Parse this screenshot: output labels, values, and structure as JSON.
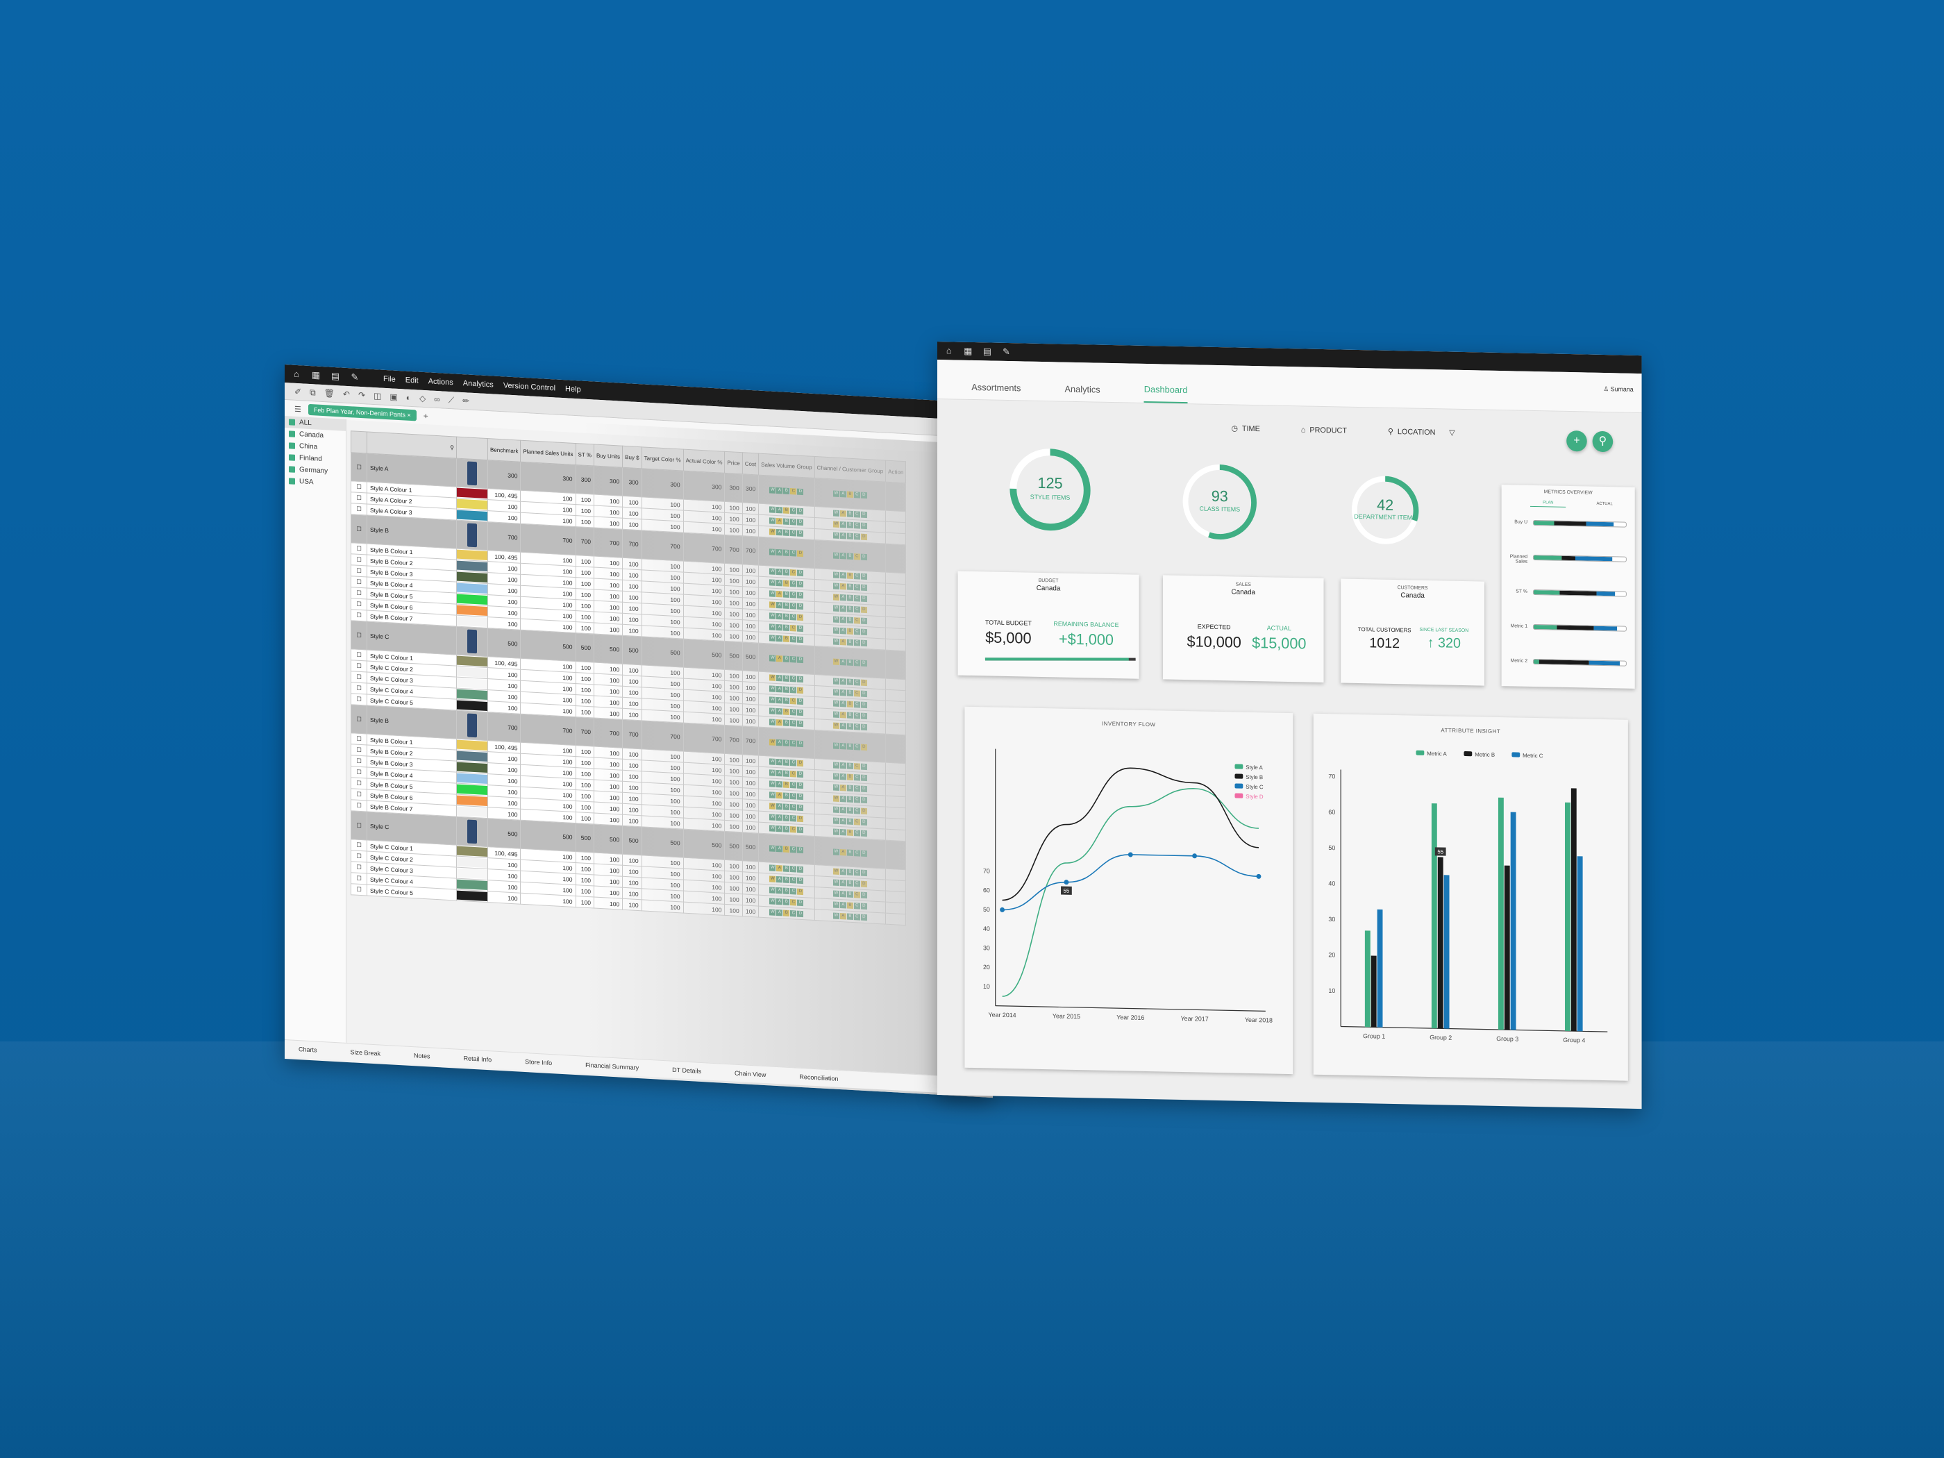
{
  "sheet": {
    "menu": [
      "File",
      "Edit",
      "Actions",
      "Analytics",
      "Version Control",
      "Help"
    ],
    "active_tab": "Feb Plan Year, Non-Denim Pants",
    "filters": [
      "ALL",
      "Canada",
      "China",
      "Finland",
      "Germany",
      "USA"
    ],
    "columns": [
      "Benchmark",
      "Planned Sales Units",
      "ST %",
      "Buy Units",
      "Buy $",
      "Target Color %",
      "Actual Color %",
      "Price",
      "Cost",
      "Sales Volume Group",
      "Channel / Customer Group",
      "Action"
    ],
    "codes": [
      "W",
      "A",
      "B",
      "C",
      "D"
    ],
    "rows": [
      {
        "type": "style",
        "name": "Style A",
        "v": [
          "300",
          "300",
          "300",
          "300",
          "300",
          "300",
          "300",
          "300",
          "300"
        ]
      },
      {
        "type": "colour",
        "name": "Style A Colour 1",
        "color": "#a01423",
        "v": [
          "100, 495",
          "100",
          "100",
          "100",
          "100",
          "100",
          "100",
          "100",
          "100"
        ]
      },
      {
        "type": "colour",
        "name": "Style A Colour 2",
        "color": "#e6d55a",
        "v": [
          "100",
          "100",
          "100",
          "100",
          "100",
          "100",
          "100",
          "100",
          "100"
        ]
      },
      {
        "type": "colour",
        "name": "Style A Colour 3",
        "color": "#2e8fb0",
        "v": [
          "100",
          "100",
          "100",
          "100",
          "100",
          "100",
          "100",
          "100",
          "100"
        ]
      },
      {
        "type": "style",
        "name": "Style B",
        "v": [
          "700",
          "700",
          "700",
          "700",
          "700",
          "700",
          "700",
          "700",
          "700"
        ]
      },
      {
        "type": "colour",
        "name": "Style B Colour 1",
        "color": "#e8c95a",
        "v": [
          "100, 495",
          "100",
          "100",
          "100",
          "100",
          "100",
          "100",
          "100",
          "100"
        ]
      },
      {
        "type": "colour",
        "name": "Style B Colour 2",
        "color": "#5b7a88",
        "v": [
          "100",
          "100",
          "100",
          "100",
          "100",
          "100",
          "100",
          "100",
          "100"
        ]
      },
      {
        "type": "colour",
        "name": "Style B Colour 3",
        "color": "#4f6440",
        "v": [
          "100",
          "100",
          "100",
          "100",
          "100",
          "100",
          "100",
          "100",
          "100"
        ]
      },
      {
        "type": "colour",
        "name": "Style B Colour 4",
        "color": "#8fc0e6",
        "v": [
          "100",
          "100",
          "100",
          "100",
          "100",
          "100",
          "100",
          "100",
          "100"
        ]
      },
      {
        "type": "colour",
        "name": "Style B Colour 5",
        "color": "#2bd64a",
        "v": [
          "100",
          "100",
          "100",
          "100",
          "100",
          "100",
          "100",
          "100",
          "100"
        ]
      },
      {
        "type": "colour",
        "name": "Style B Colour 6",
        "color": "#f39447",
        "v": [
          "100",
          "100",
          "100",
          "100",
          "100",
          "100",
          "100",
          "100",
          "100"
        ]
      },
      {
        "type": "colour",
        "name": "Style B Colour 7",
        "color": "#f4f4f4",
        "v": [
          "100",
          "100",
          "100",
          "100",
          "100",
          "100",
          "100",
          "100",
          "100"
        ]
      },
      {
        "type": "style",
        "name": "Style C",
        "v": [
          "500",
          "500",
          "500",
          "500",
          "500",
          "500",
          "500",
          "500",
          "500"
        ]
      },
      {
        "type": "colour",
        "name": "Style C Colour 1",
        "color": "#8e8e62",
        "v": [
          "100, 495",
          "100",
          "100",
          "100",
          "100",
          "100",
          "100",
          "100",
          "100"
        ]
      },
      {
        "type": "colour",
        "name": "Style C Colour 2",
        "color": "#f2f2f2",
        "v": [
          "100",
          "100",
          "100",
          "100",
          "100",
          "100",
          "100",
          "100",
          "100"
        ]
      },
      {
        "type": "colour",
        "name": "Style C Colour 3",
        "color": "#f7f7f7",
        "v": [
          "100",
          "100",
          "100",
          "100",
          "100",
          "100",
          "100",
          "100",
          "100"
        ]
      },
      {
        "type": "colour",
        "name": "Style C Colour 4",
        "color": "#5f9a7b",
        "v": [
          "100",
          "100",
          "100",
          "100",
          "100",
          "100",
          "100",
          "100",
          "100"
        ]
      },
      {
        "type": "colour",
        "name": "Style C Colour 5",
        "color": "#1d1d1d",
        "v": [
          "100",
          "100",
          "100",
          "100",
          "100",
          "100",
          "100",
          "100",
          "100"
        ]
      },
      {
        "type": "style",
        "name": "Style B",
        "v": [
          "700",
          "700",
          "700",
          "700",
          "700",
          "700",
          "700",
          "700",
          "700"
        ]
      },
      {
        "type": "colour",
        "name": "Style B Colour 1",
        "color": "#e8c95a",
        "v": [
          "100, 495",
          "100",
          "100",
          "100",
          "100",
          "100",
          "100",
          "100",
          "100"
        ]
      },
      {
        "type": "colour",
        "name": "Style B Colour 2",
        "color": "#5b7a88",
        "v": [
          "100",
          "100",
          "100",
          "100",
          "100",
          "100",
          "100",
          "100",
          "100"
        ]
      },
      {
        "type": "colour",
        "name": "Style B Colour 3",
        "color": "#4f6440",
        "v": [
          "100",
          "100",
          "100",
          "100",
          "100",
          "100",
          "100",
          "100",
          "100"
        ]
      },
      {
        "type": "colour",
        "name": "Style B Colour 4",
        "color": "#8fc0e6",
        "v": [
          "100",
          "100",
          "100",
          "100",
          "100",
          "100",
          "100",
          "100",
          "100"
        ]
      },
      {
        "type": "colour",
        "name": "Style B Colour 5",
        "color": "#2bd64a",
        "v": [
          "100",
          "100",
          "100",
          "100",
          "100",
          "100",
          "100",
          "100",
          "100"
        ]
      },
      {
        "type": "colour",
        "name": "Style B Colour 6",
        "color": "#f39447",
        "v": [
          "100",
          "100",
          "100",
          "100",
          "100",
          "100",
          "100",
          "100",
          "100"
        ]
      },
      {
        "type": "colour",
        "name": "Style B Colour 7",
        "color": "#f4f4f4",
        "v": [
          "100",
          "100",
          "100",
          "100",
          "100",
          "100",
          "100",
          "100",
          "100"
        ]
      },
      {
        "type": "style",
        "name": "Style C",
        "v": [
          "500",
          "500",
          "500",
          "500",
          "500",
          "500",
          "500",
          "500",
          "500"
        ]
      },
      {
        "type": "colour",
        "name": "Style C Colour 1",
        "color": "#8e8e62",
        "v": [
          "100, 495",
          "100",
          "100",
          "100",
          "100",
          "100",
          "100",
          "100",
          "100"
        ]
      },
      {
        "type": "colour",
        "name": "Style C Colour 2",
        "color": "#f2f2f2",
        "v": [
          "100",
          "100",
          "100",
          "100",
          "100",
          "100",
          "100",
          "100",
          "100"
        ]
      },
      {
        "type": "colour",
        "name": "Style C Colour 3",
        "color": "#f7f7f7",
        "v": [
          "100",
          "100",
          "100",
          "100",
          "100",
          "100",
          "100",
          "100",
          "100"
        ]
      },
      {
        "type": "colour",
        "name": "Style C Colour 4",
        "color": "#5f9a7b",
        "v": [
          "100",
          "100",
          "100",
          "100",
          "100",
          "100",
          "100",
          "100",
          "100"
        ]
      },
      {
        "type": "colour",
        "name": "Style C Colour 5",
        "color": "#1d1d1d",
        "v": [
          "100",
          "100",
          "100",
          "100",
          "100",
          "100",
          "100",
          "100",
          "100"
        ]
      }
    ],
    "bottom_tabs": [
      "Charts",
      "Size Break",
      "Notes",
      "Retail Info",
      "Store Info",
      "Financial Summary",
      "DT Details",
      "Chain View",
      "Reconciliation"
    ]
  },
  "dash": {
    "tabs": [
      "Assortments",
      "Analytics",
      "Dashboard"
    ],
    "active_tab": "Dashboard",
    "user": "Sumana",
    "filters": [
      "TIME",
      "PRODUCT",
      "LOCATION"
    ],
    "accent": "#3fae83",
    "rings": [
      {
        "value": "125",
        "label": "STYLE ITEMS",
        "fraction": 0.75
      },
      {
        "value": "93",
        "label": "CLASS ITEMS",
        "fraction": 0.55
      },
      {
        "value": "42",
        "label": "DEPARTMENT ITEMS",
        "fraction": 0.3
      }
    ],
    "budget": {
      "title": "BUDGET",
      "region": "Canada",
      "k1": "TOTAL BUDGET",
      "v1": "$5,000",
      "k2": "REMAINING BALANCE",
      "v2": "+$1,000"
    },
    "sales": {
      "title": "SALES",
      "region": "Canada",
      "k1": "EXPECTED",
      "v1": "$10,000",
      "k2": "ACTUAL",
      "v2": "$15,000"
    },
    "customers": {
      "title": "CUSTOMERS",
      "region": "Canada",
      "k1": "TOTAL CUSTOMERS",
      "v1": "1012",
      "k2": "SINCE LAST SEASON",
      "v2": "↑ 320"
    },
    "metrics": {
      "title": "METRICS OVERVIEW",
      "tabs": [
        "PLAN",
        "ACTUAL"
      ],
      "rows": [
        {
          "label": "Buy U",
          "green": 0.22,
          "black": 0.35,
          "blue": 0.3
        },
        {
          "label": "Planned Sales",
          "green": 0.3,
          "black": 0.15,
          "blue": 0.4
        },
        {
          "label": "ST %",
          "green": 0.28,
          "black": 0.4,
          "blue": 0.2
        },
        {
          "label": "Metric 1",
          "green": 0.25,
          "black": 0.4,
          "blue": 0.25
        },
        {
          "label": "Metric 2",
          "green": 0.06,
          "black": 0.54,
          "blue": 0.33
        }
      ]
    }
  },
  "chart_data": [
    {
      "type": "line",
      "title": "INVENTORY FLOW",
      "x": [
        "Year 2014",
        "Year 2015",
        "Year 2016",
        "Year 2017",
        "Year 2018"
      ],
      "yticks": [
        10,
        20,
        30,
        40,
        50,
        60,
        70
      ],
      "ylim": [
        0,
        130
      ],
      "series": [
        {
          "name": "Style A",
          "color": "#3fae83",
          "values": [
            5,
            75,
            105,
            115,
            95
          ]
        },
        {
          "name": "Style B",
          "color": "#1a1a1a",
          "values": [
            55,
            95,
            125,
            118,
            85
          ]
        },
        {
          "name": "Style C",
          "color": "#1a78b8",
          "values": [
            50,
            65,
            80,
            80,
            70
          ]
        },
        {
          "name": "Style D",
          "color": "#f06ba4",
          "values": []
        }
      ],
      "annotation": {
        "series": "Style C",
        "x": "Year 2015",
        "label": "55"
      },
      "legend": "top-right"
    },
    {
      "type": "bar",
      "title": "ATTRIBUTE INSIGHT",
      "categories": [
        "Group 1",
        "Group 2",
        "Group 3",
        "Group 4"
      ],
      "yticks": [
        10,
        20,
        30,
        40,
        50,
        60,
        70
      ],
      "ylim": [
        0,
        70
      ],
      "series": [
        {
          "name": "Metric A",
          "color": "#3fae83",
          "values": [
            27,
            63,
            65,
            64
          ]
        },
        {
          "name": "Metric B",
          "color": "#1a1a1a",
          "values": [
            20,
            48,
            46,
            68
          ]
        },
        {
          "name": "Metric C",
          "color": "#1a78b8",
          "values": [
            33,
            43,
            61,
            49
          ]
        }
      ],
      "annotation": {
        "series": "Metric B",
        "category": "Group 2",
        "label": "55"
      },
      "legend": "top"
    }
  ]
}
